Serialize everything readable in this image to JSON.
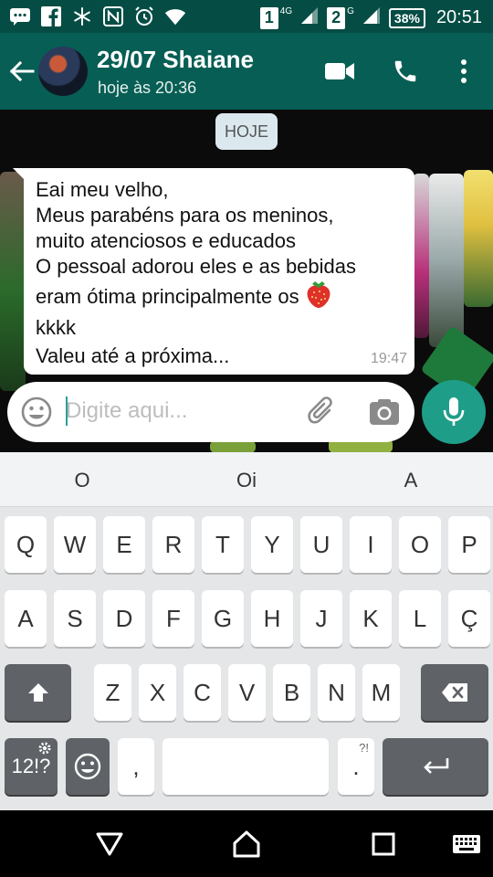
{
  "status_bar": {
    "sim1": "1",
    "sim1_network": "4G",
    "sim2": "2",
    "sim2_network": "G",
    "battery": "38%",
    "time": "20:51"
  },
  "header": {
    "contact_name": "29/07 Shaiane",
    "last_seen": "hoje às 20:36"
  },
  "chat": {
    "date_chip": "HOJE",
    "message": {
      "lines": [
        "Eai meu velho,",
        "Meus parabéns para os meninos,",
        "muito atenciosos e educados",
        "O pessoal adorou eles e as bebidas",
        "eram ótima principalmente os",
        "kkkk",
        "Valeu até a próxima..."
      ],
      "time": "19:47",
      "emoji": "strawberry-icon"
    }
  },
  "composer": {
    "placeholder": "Digite aqui...",
    "value": ""
  },
  "keyboard": {
    "suggestions": [
      "O",
      "Oi",
      "A"
    ],
    "row1": [
      "Q",
      "W",
      "E",
      "R",
      "T",
      "Y",
      "U",
      "I",
      "O",
      "P"
    ],
    "row2": [
      "A",
      "S",
      "D",
      "F",
      "G",
      "H",
      "J",
      "K",
      "L",
      "Ç"
    ],
    "row3": [
      "Z",
      "X",
      "C",
      "V",
      "B",
      "N",
      "M"
    ],
    "symbols_key": "12!?",
    "comma_key": ",",
    "period_key": ".",
    "period_alt": "?!"
  },
  "colors": {
    "header": "#075e54",
    "status_bar": "#054d44",
    "accent": "#1e9e89"
  }
}
